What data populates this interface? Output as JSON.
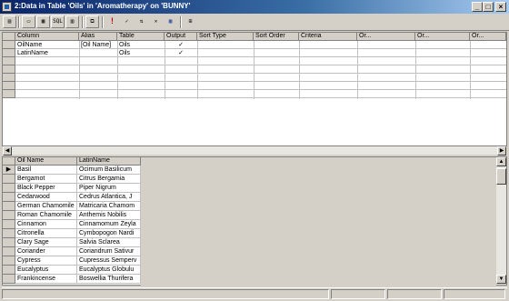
{
  "window": {
    "title": "2:Data in Table 'Oils' in 'Aromatherapy' on 'BUNNY'",
    "min_glyph": "_",
    "max_glyph": "□",
    "close_glyph": "×"
  },
  "toolbar": {
    "buttons": [
      {
        "name": "sql-pane-icon",
        "glyph": "▤"
      },
      {
        "name": "diagram-pane-icon",
        "glyph": "▭"
      },
      {
        "name": "grid-pane-icon",
        "glyph": "▦"
      },
      {
        "name": "sql-button",
        "glyph": "SQL"
      },
      {
        "name": "results-pane-icon",
        "glyph": "▥"
      },
      {
        "name": "change-type-icon",
        "glyph": "⧉"
      },
      {
        "name": "run-icon",
        "glyph": "!"
      },
      {
        "name": "verify-sql-icon",
        "glyph": "✓"
      },
      {
        "name": "sort-icon",
        "glyph": "⇅"
      },
      {
        "name": "remove-filter-icon",
        "glyph": "✕"
      },
      {
        "name": "group-by-icon",
        "glyph": "▦"
      },
      {
        "name": "add-table-icon",
        "glyph": "⊞"
      }
    ]
  },
  "grid": {
    "columns": [
      "Column",
      "Alias",
      "Table",
      "Output",
      "Sort Type",
      "Sort Order",
      "Criteria",
      "Or...",
      "Or...",
      "Or..."
    ],
    "rows": [
      {
        "column": "OilName",
        "alias": "[Oil Name]",
        "table": "Oils",
        "output": "✓"
      },
      {
        "column": "LatinName",
        "alias": "",
        "table": "Oils",
        "output": "✓"
      }
    ]
  },
  "results": {
    "columns": [
      "Oil Name",
      "LatinName"
    ],
    "current_row_marker": "▶",
    "rows": [
      [
        "Basil",
        "Ocimum Basilicum"
      ],
      [
        "Bergamot",
        "Citrus Bergamia"
      ],
      [
        "Black Pepper",
        "Piper Nigrum"
      ],
      [
        "Cedarwood",
        "Cedrus Atlantica, J"
      ],
      [
        "German Chamomile",
        "Matricaria Chamom"
      ],
      [
        "Roman Chamomile",
        "Anthemis Nobilis"
      ],
      [
        "Cinnamon",
        "Cinnamomum Zeyla"
      ],
      [
        "Citronella",
        "Cymbopogon Nardi"
      ],
      [
        "Clary Sage",
        "Salvia Sclarea"
      ],
      [
        "Coriander",
        "Coriandrum Sativur"
      ],
      [
        "Cypress",
        "Cupressus Semperv"
      ],
      [
        "Eucalyptus",
        "Eucalyptus Globulu"
      ],
      [
        "Frankincense",
        "Boswellia Thurifera"
      ]
    ]
  },
  "scroll": {
    "left_arrow": "◀",
    "right_arrow": "▶",
    "up_arrow": "▲",
    "down_arrow": "▼"
  }
}
